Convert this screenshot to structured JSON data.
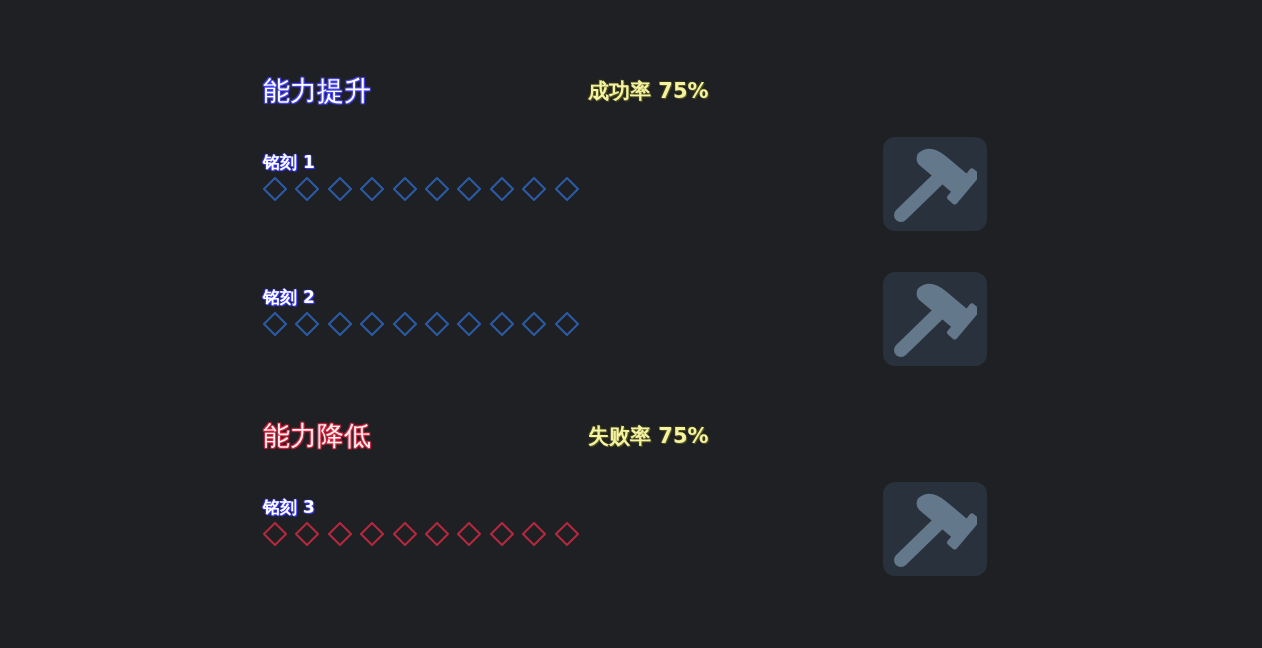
{
  "sections": [
    {
      "kind": "boost",
      "title": "能力提升",
      "rate": "成功率 75%",
      "inscriptions": [
        {
          "label": "铭刻 1",
          "slots": [
            {
              "filled": false
            },
            {
              "filled": false
            },
            {
              "filled": false
            },
            {
              "filled": false
            },
            {
              "filled": false
            },
            {
              "filled": false
            },
            {
              "filled": false
            },
            {
              "filled": false
            },
            {
              "filled": false
            },
            {
              "filled": false
            }
          ]
        },
        {
          "label": "铭刻 2",
          "slots": [
            {
              "filled": false
            },
            {
              "filled": false
            },
            {
              "filled": false
            },
            {
              "filled": false
            },
            {
              "filled": false
            },
            {
              "filled": false
            },
            {
              "filled": false
            },
            {
              "filled": false
            },
            {
              "filled": false
            },
            {
              "filled": false
            }
          ]
        }
      ]
    },
    {
      "kind": "reduce",
      "title": "能力降低",
      "rate": "失败率 75%",
      "inscriptions": [
        {
          "label": "铭刻 3",
          "slots": [
            {
              "filled": false
            },
            {
              "filled": false
            },
            {
              "filled": false
            },
            {
              "filled": false
            },
            {
              "filled": false
            },
            {
              "filled": false
            },
            {
              "filled": false
            },
            {
              "filled": false
            },
            {
              "filled": false
            },
            {
              "filled": false
            }
          ]
        }
      ]
    }
  ]
}
